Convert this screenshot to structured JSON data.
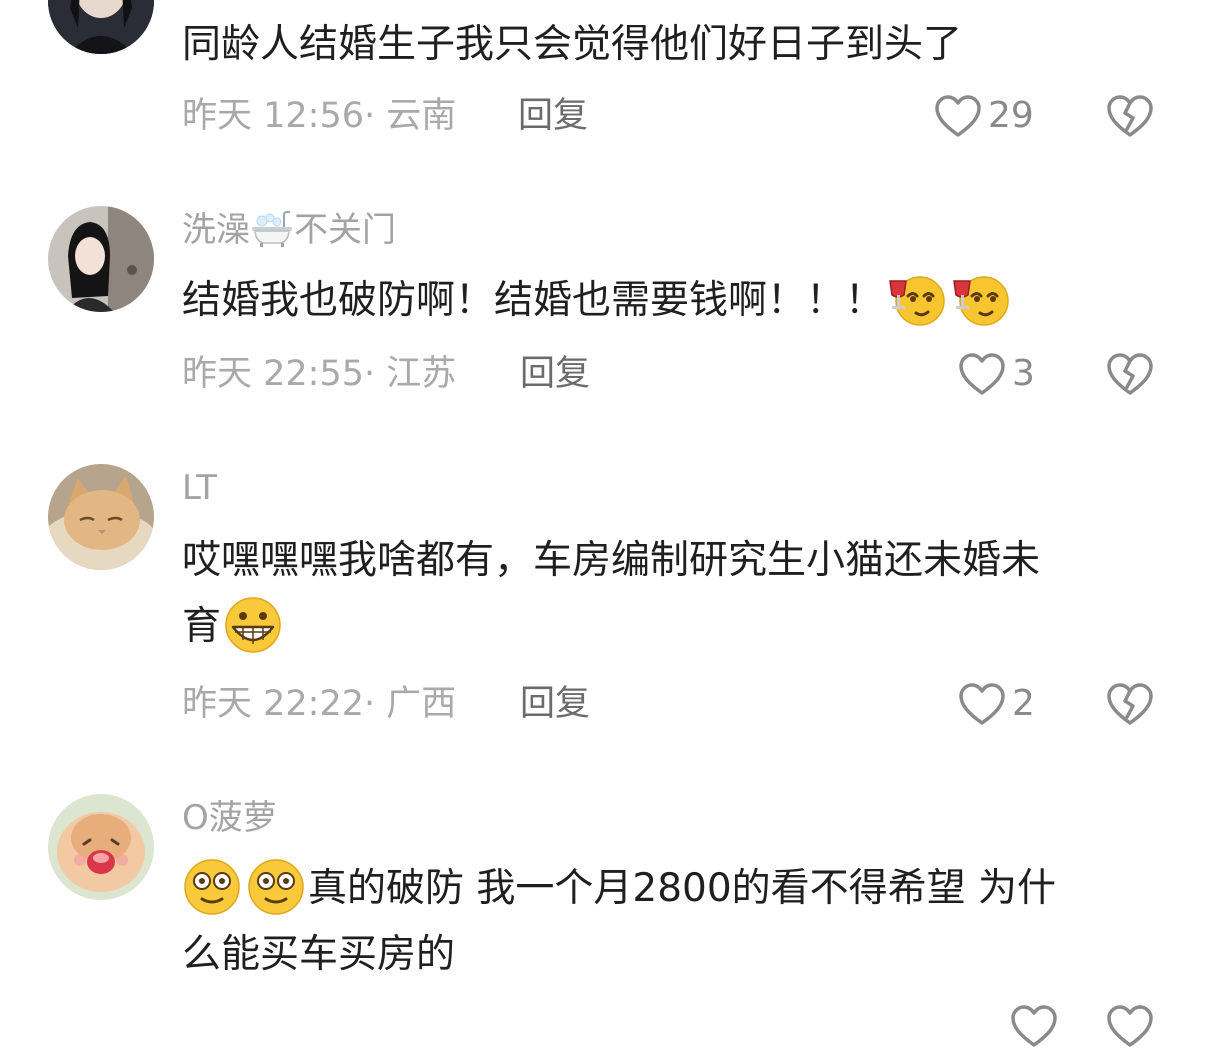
{
  "comments": [
    {
      "username": "",
      "text": "同龄人结婚生子我只会觉得他们好日子到头了",
      "meta": "昨天 12:56· 云南",
      "reply_label": "回复",
      "likes": "29",
      "avatar_icon": "user-avatar-icon"
    },
    {
      "username_part1": "洗澡",
      "username_part2": "不关门",
      "username_emoji": "bathtub-icon",
      "text": "结婚我也破防啊！结婚也需要钱啊！！！",
      "text_emojis": [
        "toast-emoji-icon",
        "toast-emoji-icon"
      ],
      "meta": "昨天 22:55· 江苏",
      "reply_label": "回复",
      "likes": "3",
      "avatar_icon": "user-avatar-icon"
    },
    {
      "username": "LT",
      "text_line1": "哎嘿嘿嘿我啥都有，车房编制研究生小猫还未婚未",
      "text_line2": "育",
      "text_emojis": [
        "grin-emoji-icon"
      ],
      "meta": "昨天 22:22· 广西",
      "reply_label": "回复",
      "likes": "2",
      "avatar_icon": "cat-avatar-icon"
    },
    {
      "username": "O菠萝",
      "text_line1": "真的破防 我一个月2800的看不得希望 为什",
      "text_line2": "么能买车买房的",
      "text_emojis": [
        "dizzy-emoji-icon",
        "dizzy-emoji-icon"
      ],
      "avatar_icon": "hamster-avatar-icon"
    }
  ],
  "colors": {
    "text": "#1f1f1f",
    "meta": "#a9a9a9",
    "reply": "#6b6b6b",
    "icon": "#8a8a8a"
  }
}
